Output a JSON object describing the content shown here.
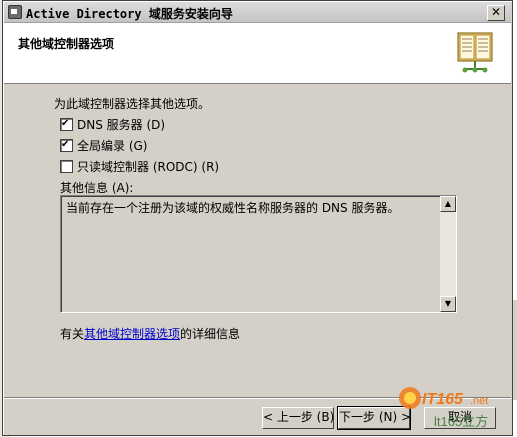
{
  "window": {
    "title": "Active Directory 域服务安装向导",
    "close_glyph": "✕"
  },
  "header": {
    "title": "其他域控制器选项",
    "icon": "book-icon"
  },
  "content": {
    "intro": "为此域控制器选择其他选项。",
    "options": [
      {
        "label": "DNS 服务器 (D)",
        "checked": true
      },
      {
        "label": "全局编录 (G)",
        "checked": true
      },
      {
        "label": "只读域控制器 (RODC) (R)",
        "checked": false
      }
    ],
    "other_info_label": "其他信息 (A):",
    "other_info_text": "当前存在一个注册为该域的权威性名称服务器的 DNS 服务器。",
    "help_prefix": "有关",
    "help_link": "其他域控制器选项",
    "help_suffix": "的详细信息"
  },
  "buttons": {
    "back": "< 上一步 (B)",
    "next": "下一步 (N) >",
    "cancel": "取消"
  },
  "watermark": {
    "text": "IT165",
    "suffix": ".net",
    "brand": "lt165立方"
  },
  "colors": {
    "dialog_bg": "#d4d0c8",
    "link": "#0000cc",
    "watermark_orange": "#f07a1a"
  }
}
